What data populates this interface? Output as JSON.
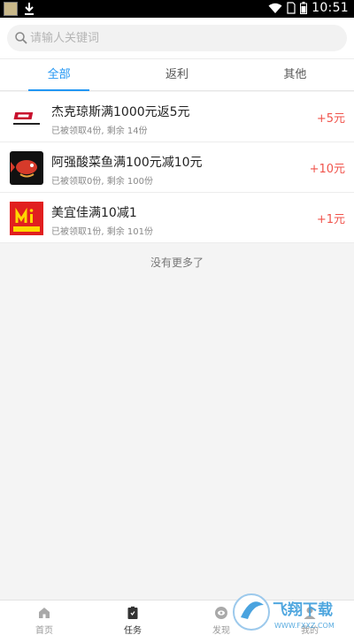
{
  "status_bar": {
    "time": "10:51"
  },
  "search": {
    "placeholder": "请输人关键词"
  },
  "tabs": [
    {
      "label": "全部",
      "active": true
    },
    {
      "label": "返利",
      "active": false
    },
    {
      "label": "其他",
      "active": false
    }
  ],
  "tasks": [
    {
      "title": "杰克琼斯满1000元返5元",
      "subtitle": "已被领取4份, 剩余 14份",
      "reward": "+5元",
      "logo_text": "JACK&JONES"
    },
    {
      "title": "阿强酸菜鱼满100元减10元",
      "subtitle": "已被领取0份, 剩余 100份",
      "reward": "+10元"
    },
    {
      "title": "美宜佳满10减1",
      "subtitle": "已被领取1份, 剩余 101份",
      "reward": "+1元",
      "logo_text": "美宜佳"
    }
  ],
  "no_more": "没有更多了",
  "bottom_nav": [
    {
      "label": "首页",
      "icon": "home-icon"
    },
    {
      "label": "任务",
      "icon": "task-icon",
      "active": true
    },
    {
      "label": "发现",
      "icon": "discover-icon"
    },
    {
      "label": "我的",
      "icon": "profile-icon"
    }
  ],
  "watermark": {
    "text": "飞翔下载",
    "url": "WWW.FXXZ.COM"
  },
  "colors": {
    "accent": "#2196f3",
    "reward": "#f0534b"
  }
}
